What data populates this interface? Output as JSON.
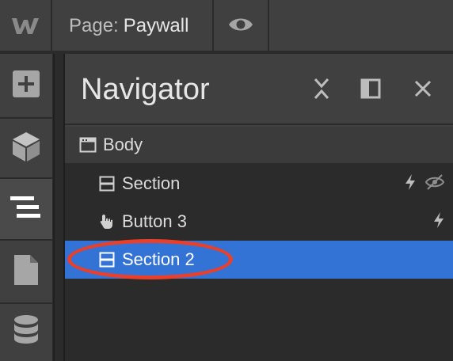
{
  "topbar": {
    "logo_icon": "webflow-logo-icon",
    "page_prefix": "Page:",
    "page_name": "Paywall",
    "preview_icon": "eye-icon"
  },
  "rail": {
    "items": [
      {
        "icon": "plus-icon",
        "label": "Add"
      },
      {
        "icon": "cube-icon",
        "label": "Symbols"
      },
      {
        "icon": "navigator-icon",
        "label": "Navigator",
        "active": true
      },
      {
        "icon": "page-icon",
        "label": "Pages"
      },
      {
        "icon": "database-icon",
        "label": "CMS"
      }
    ]
  },
  "navigator": {
    "title": "Navigator",
    "collapse_icon": "collapse-icon",
    "dock_icon": "dock-panel-icon",
    "close_icon": "close-icon",
    "tree": [
      {
        "label": "Body",
        "icon": "body-icon",
        "level": 0
      },
      {
        "label": "Section",
        "icon": "section-icon",
        "level": 1,
        "actions": [
          "interaction-icon",
          "hidden-eye-icon"
        ]
      },
      {
        "label": "Button 3",
        "icon": "hand-pointer-icon",
        "level": 1,
        "actions": [
          "interaction-icon"
        ]
      },
      {
        "label": "Section 2",
        "icon": "section-icon",
        "level": 1,
        "selected": true,
        "annotated": true
      }
    ]
  },
  "colors": {
    "accent": "#3373d6",
    "annotation": "#e8402a",
    "panel": "#404040",
    "background": "#2b2b2b"
  }
}
